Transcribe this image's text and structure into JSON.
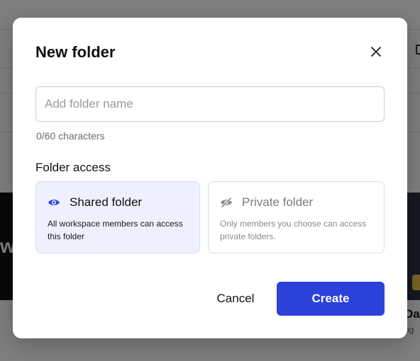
{
  "background": {
    "card_title": "Das",
    "card_subtitle": "ug",
    "dark_tile_text": "w",
    "badge_color": "#f2c94c"
  },
  "modal": {
    "title": "New folder",
    "close_icon": "close-icon",
    "name_input": {
      "placeholder": "Add folder name",
      "value": ""
    },
    "char_count": "0/60 characters",
    "access_heading": "Folder access",
    "options": [
      {
        "label": "Shared folder",
        "description": "All workspace members can access this folder",
        "icon": "eye-icon",
        "selected": true
      },
      {
        "label": "Private folder",
        "description": "Only members you choose can access private folders.",
        "icon": "eye-slash-icon",
        "selected": false
      }
    ],
    "cancel_label": "Cancel",
    "create_label": "Create"
  },
  "colors": {
    "accent": "#2b41d9",
    "selected_option_bg": "#eef0fd",
    "overlay": "rgba(0,0,0,0.5)"
  }
}
